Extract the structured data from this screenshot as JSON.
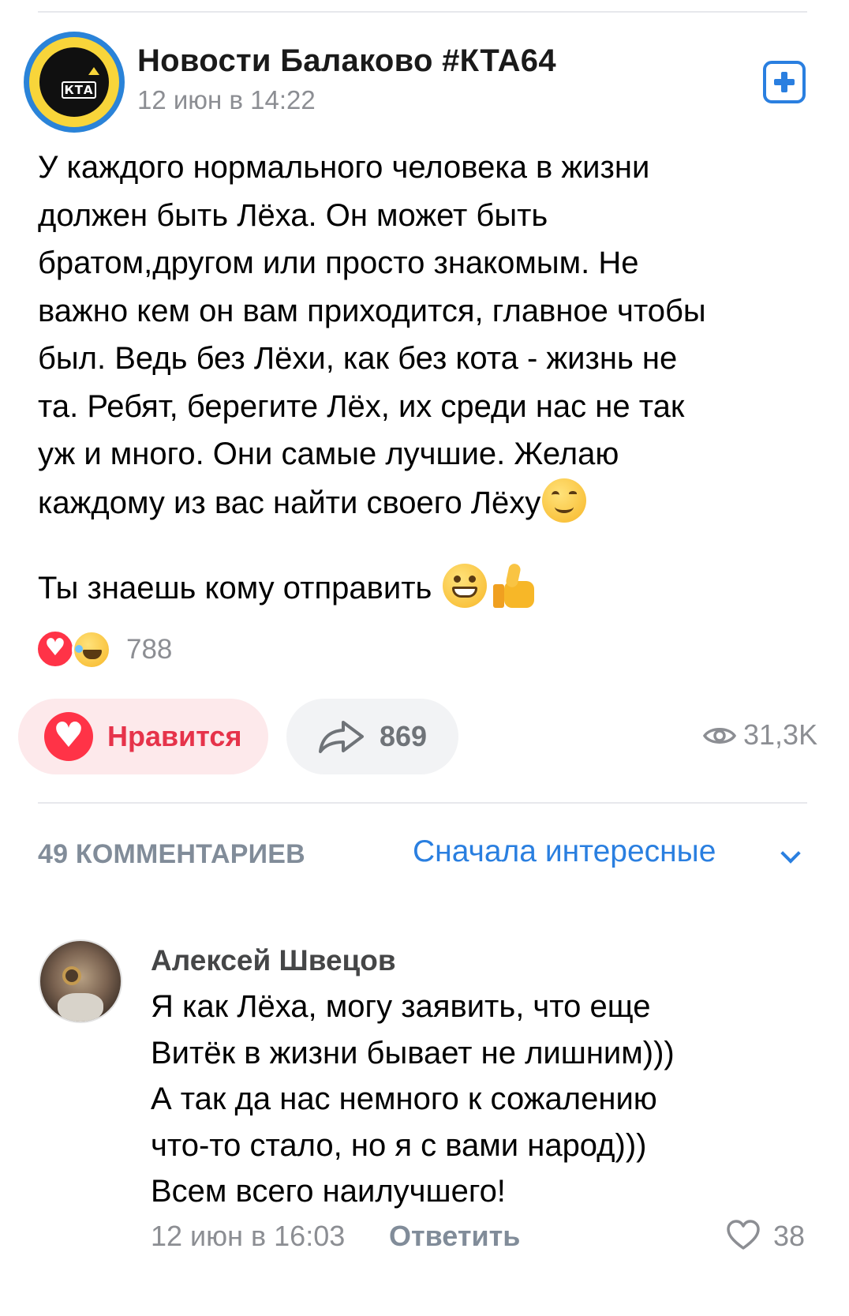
{
  "post": {
    "group_name": "Новости Балаково #КТА64",
    "time": "12 июн в 14:22",
    "logo_text": "КТА",
    "text_lines": [
      "У каждого нормального человека в жизни",
      "должен быть Лёха. Он может быть",
      "братом,другом или просто знакомым. Не",
      "важно кем он вам приходится, главное чтобы",
      "был. Ведь без Лёхи, как без кота - жизнь не",
      "та. Ребят, берегите Лёх, их среди нас не так",
      "уж и много. Они самые лучшие. Желаю",
      "каждому из вас найти своего Лёху"
    ],
    "cta": "Ты знаешь кому отправить",
    "reactions_count": "788",
    "like_label": "Нравится",
    "shares_count": "869",
    "views": "31,3K"
  },
  "comments": {
    "count_label": "49 КОММЕНТАРИЕВ",
    "sort_label": "Сначала интересные",
    "items": [
      {
        "author": "Алексей Швецов",
        "text_lines": [
          "Я как Лёха, могу заявить, что еще",
          "Витёк в жизни бывает не лишним)))",
          "А так да нас немного к сожалению",
          "что-то стало, но я с вами народ)))",
          "Всем всего наилучшего!"
        ],
        "time": "12 июн в 16:03",
        "reply_label": "Ответить",
        "likes": "38"
      }
    ]
  },
  "icons": {
    "subscribe": "plus-square-icon",
    "like": "heart-icon",
    "share": "share-arrow-icon",
    "views": "eye-icon",
    "sort": "chevron-down-icon",
    "comment_like": "heart-outline-icon"
  },
  "colors": {
    "accent": "#2a7fe0",
    "like_red": "#ff3347",
    "muted": "#8c8e93"
  }
}
